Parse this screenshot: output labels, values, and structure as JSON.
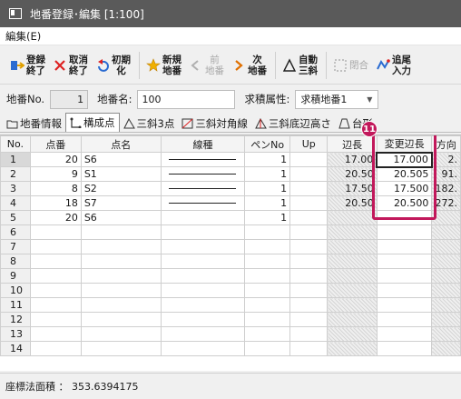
{
  "window": {
    "title": "地番登録･編集 [1:100]"
  },
  "menu": {
    "edit_label": "編集(E)"
  },
  "toolbar": {
    "register_end": "登録\n終了",
    "cancel_end": "取消\n終了",
    "initialize": "初期\n化",
    "new_lot": "新規\n地番",
    "prev_lot": "前\n地番",
    "next_lot": "次\n地番",
    "auto_triangle": "自動\n三斜",
    "close": "閉合",
    "append_input": "追尾\n入力"
  },
  "fields": {
    "lot_no_label": "地番No.",
    "lot_no_value": "1",
    "lot_name_label": "地番名:",
    "lot_name_value": "100",
    "area_attr_label": "求積属性:",
    "area_attr_value": "求積地番1"
  },
  "tabs": [
    "地番情報",
    "構成点",
    "三斜3点",
    "三斜対角線",
    "三斜底辺高さ",
    "台形"
  ],
  "grid": {
    "headers": [
      "No.",
      "点番",
      "点名",
      "線種",
      "ペンNo",
      "Up",
      "辺長",
      "変更辺長",
      "方向"
    ],
    "rows": [
      {
        "no": "1",
        "pt": "20",
        "name": "S6",
        "pen": "1",
        "len": "17.00",
        "chg": "17.000",
        "dir": "2."
      },
      {
        "no": "2",
        "pt": "9",
        "name": "S1",
        "pen": "1",
        "len": "20.50",
        "chg": "20.505",
        "dir": "91."
      },
      {
        "no": "3",
        "pt": "8",
        "name": "S2",
        "pen": "1",
        "len": "17.50",
        "chg": "17.500",
        "dir": "182."
      },
      {
        "no": "4",
        "pt": "18",
        "name": "S7",
        "pen": "1",
        "len": "20.50",
        "chg": "20.500",
        "dir": "272."
      },
      {
        "no": "5",
        "pt": "20",
        "name": "S6",
        "pen": "1",
        "len": "",
        "chg": "",
        "dir": ""
      },
      {
        "no": "6"
      },
      {
        "no": "7"
      },
      {
        "no": "8"
      },
      {
        "no": "9"
      },
      {
        "no": "10"
      },
      {
        "no": "11"
      },
      {
        "no": "12"
      },
      {
        "no": "13"
      },
      {
        "no": "14"
      }
    ]
  },
  "callout": {
    "badge": "11"
  },
  "status": {
    "area_text": "座標法面積 ： 353.6394175"
  },
  "colors": {
    "accent": "#c2185b",
    "titlebar": "#5a5a5a"
  }
}
